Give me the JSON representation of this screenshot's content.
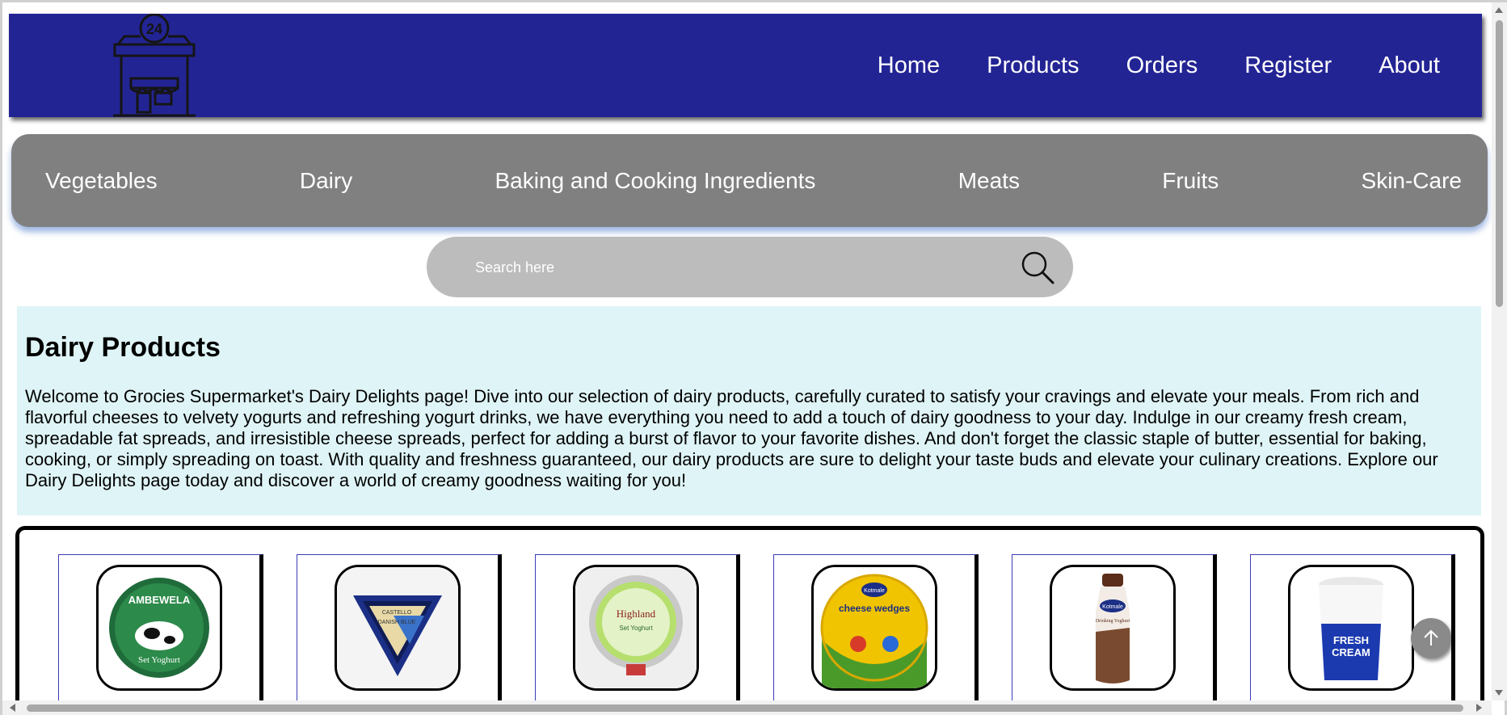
{
  "header": {
    "logo_badge": "24",
    "nav": [
      "Home",
      "Products",
      "Orders",
      "Register",
      "About"
    ]
  },
  "categories": [
    "Vegetables",
    "Dairy",
    "Baking and Cooking Ingredients",
    "Meats",
    "Fruits",
    "Skin-Care"
  ],
  "search": {
    "placeholder": "Search here"
  },
  "intro": {
    "title": "Dairy Products",
    "text": "Welcome to Grocies Supermarket's Dairy Delights page! Dive into our selection of dairy products, carefully curated to satisfy your cravings and elevate your meals. From rich and flavorful cheeses to velvety yogurts and refreshing yogurt drinks, we have everything you need to add a touch of dairy goodness to your day. Indulge in our creamy fresh cream, spreadable fat spreads, and irresistible cheese spreads, perfect for adding a burst of flavor to your favorite dishes. And don't forget the classic staple of butter, essential for baking, cooking, or simply spreading on toast. With quality and freshness guaranteed, our dairy products are sure to delight your taste buds and elevate your culinary creations. Explore our Dairy Delights page today and discover a world of creamy goodness waiting for you!"
  },
  "products": [
    {
      "image": "set-yogurt-cup",
      "label": "AMBEWELA",
      "sub": "Set Yoghurt"
    },
    {
      "image": "danish-blue-cheese",
      "label": "CASTELLO",
      "sub": "DANISH BLUE"
    },
    {
      "image": "highland-yogurt-cup",
      "label": "Highland",
      "sub": "Set Yoghurt"
    },
    {
      "image": "cheese-wedges-box",
      "label": "Kotmale",
      "sub": "cheese wedges"
    },
    {
      "image": "drinking-yoghurt-bottle",
      "label": "Kotmale",
      "sub": "Drinking Yoghurt"
    },
    {
      "image": "fresh-cream-cup",
      "label": "FRESH",
      "sub": "CREAM"
    }
  ],
  "colors": {
    "header": "#232494",
    "category_bar": "#808080",
    "search": "#bdbcbd",
    "intro_bg": "#dff4f6"
  }
}
